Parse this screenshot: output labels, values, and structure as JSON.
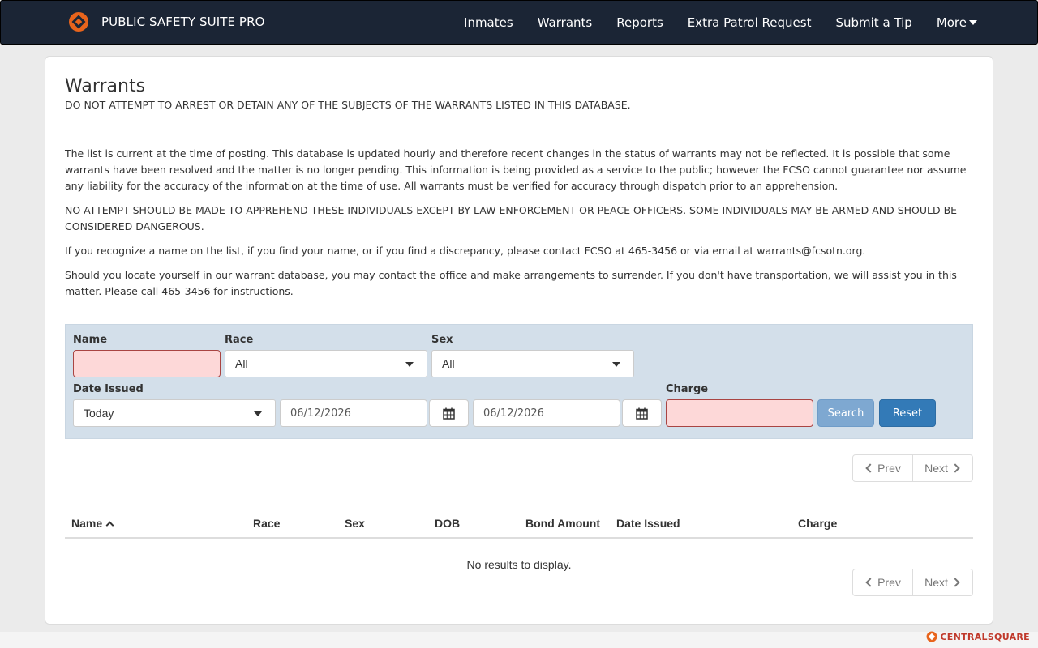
{
  "navbar": {
    "brand": "PUBLIC SAFETY SUITE PRO",
    "items": [
      "Inmates",
      "Warrants",
      "Reports",
      "Extra Patrol Request",
      "Submit a Tip"
    ],
    "more_label": "More"
  },
  "page": {
    "title": "Warrants",
    "notice": "DO NOT ATTEMPT TO ARREST OR DETAIN ANY OF THE SUBJECTS OF THE WARRANTS LISTED IN THIS DATABASE.",
    "paragraphs": [
      "The list is current at the time of posting. This database is updated hourly and therefore recent changes in the status of warrants may not be reflected. It is possible that some warrants have been resolved and the matter is no longer pending. This information is being provided as a service to the public; however the FCSO cannot guarantee nor assume any liability for the accuracy of the information at the time of use. All warrants must be verified for accuracy through dispatch prior to an apprehension.",
      "NO ATTEMPT SHOULD BE MADE TO APPREHEND THESE INDIVIDUALS EXCEPT BY LAW ENFORCEMENT OR PEACE OFFICERS. SOME INDIVIDUALS MAY BE ARMED AND SHOULD BE CONSIDERED DANGEROUS.",
      "If you recognize a name on the list, if you find your name, or if you find a discrepancy, please contact FCSO at 465-3456 or via email at warrants@fcsotn.org.",
      "Should you locate yourself in our warrant database, you may contact the office and make arrangements to surrender. If you don't have transportation, we will assist you in this matter. Please call 465-3456 for instructions."
    ]
  },
  "filters": {
    "name_label": "Name",
    "name_value": "",
    "race_label": "Race",
    "race_value": "All",
    "sex_label": "Sex",
    "sex_value": "All",
    "date_issued_label": "Date Issued",
    "date_issued_value": "Today",
    "date_from": "06/12/2026",
    "date_to": "06/12/2026",
    "charge_label": "Charge",
    "charge_value": "",
    "search_label": "Search",
    "reset_label": "Reset"
  },
  "pagination": {
    "prev_label": "Prev",
    "next_label": "Next"
  },
  "table": {
    "columns": [
      "Name",
      "Race",
      "Sex",
      "DOB",
      "Bond Amount",
      "Date Issued",
      "Charge"
    ],
    "sort_column": "Name",
    "sort_direction": "asc",
    "empty_message": "No results to display."
  },
  "footer": {
    "logo_text": "CENTRALSQUARE"
  },
  "colors": {
    "navbar_bg": "#1b2535",
    "brand_orange": "#e8641c",
    "filter_bg": "#d3dfea",
    "error_input_bg": "#fdd8d8",
    "primary_button": "#337ab7",
    "search_button": "#7ea8d1"
  }
}
